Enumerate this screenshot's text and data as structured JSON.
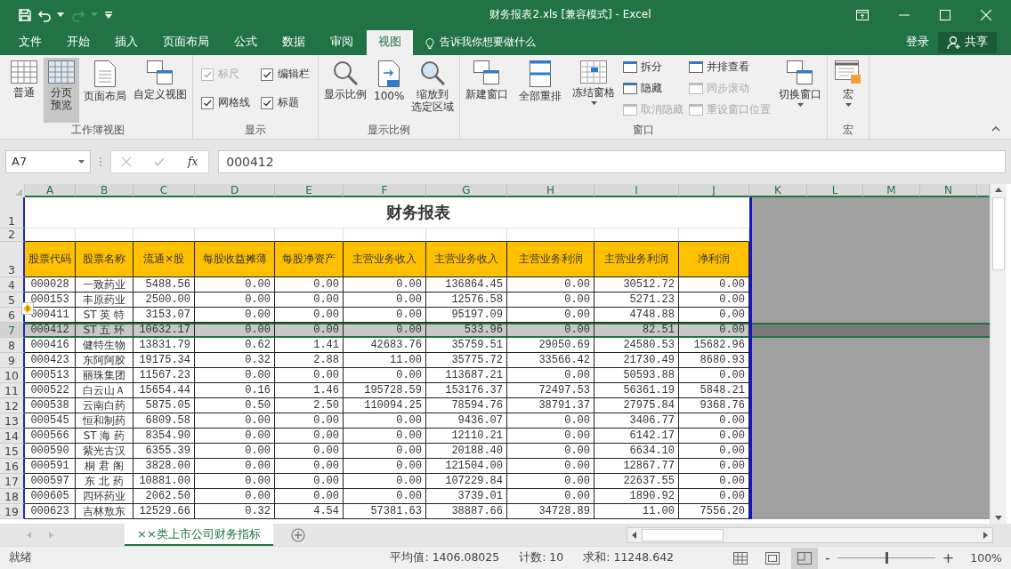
{
  "window": {
    "title": "财务报表2.xls  [兼容模式] - Excel"
  },
  "tabs": [
    {
      "label": "文件",
      "selected": false
    },
    {
      "label": "开始",
      "selected": false
    },
    {
      "label": "插入",
      "selected": false
    },
    {
      "label": "页面布局",
      "selected": false
    },
    {
      "label": "公式",
      "selected": false
    },
    {
      "label": "数据",
      "selected": false
    },
    {
      "label": "审阅",
      "selected": false
    },
    {
      "label": "视图",
      "selected": true
    }
  ],
  "tell_me": {
    "placeholder": "告诉我你想要做什么"
  },
  "sign_in": "登录",
  "share": "共享",
  "ribbon": {
    "groups": [
      {
        "label": "工作簿视图",
        "items": [
          {
            "kind": "large",
            "label": "普通",
            "selected": false,
            "disabled": false,
            "dropdown": false
          },
          {
            "kind": "large",
            "lines": [
              "分页",
              "预览"
            ],
            "selected": true,
            "disabled": false,
            "dropdown": false
          },
          {
            "kind": "large",
            "label": "页面布局",
            "selected": false,
            "disabled": false,
            "dropdown": false
          },
          {
            "kind": "large",
            "label": "自定义视图",
            "selected": false,
            "disabled": false,
            "dropdown": false
          }
        ]
      },
      {
        "label": "显示",
        "items": [
          {
            "kind": "check",
            "label": "标尺",
            "checked": true,
            "disabled": true
          },
          {
            "kind": "check",
            "label": "网格线",
            "checked": true,
            "disabled": false
          },
          {
            "kind": "check",
            "label": "编辑栏",
            "checked": true,
            "disabled": false
          },
          {
            "kind": "check",
            "label": "标题",
            "checked": true,
            "disabled": false
          }
        ]
      },
      {
        "label": "显示比例",
        "items": [
          {
            "kind": "large",
            "label": "显示比例",
            "selected": false,
            "disabled": false,
            "dropdown": false
          },
          {
            "kind": "large",
            "label": "100%",
            "selected": false,
            "disabled": false,
            "dropdown": false
          },
          {
            "kind": "large",
            "lines": [
              "缩放到",
              "选定区域"
            ],
            "selected": false,
            "disabled": false,
            "dropdown": false
          }
        ]
      },
      {
        "label": "窗口",
        "items": [
          {
            "kind": "large",
            "label": "新建窗口",
            "selected": false,
            "disabled": false,
            "dropdown": false
          },
          {
            "kind": "large",
            "label": "全部重排",
            "selected": false,
            "disabled": false,
            "dropdown": false
          },
          {
            "kind": "large",
            "label": "冻结窗格",
            "selected": false,
            "disabled": false,
            "dropdown": true
          },
          {
            "kind": "small",
            "label": "拆分",
            "disabled": false
          },
          {
            "kind": "small",
            "label": "隐藏",
            "disabled": false
          },
          {
            "kind": "small",
            "label": "取消隐藏",
            "disabled": true
          },
          {
            "kind": "small",
            "label": "并排查看",
            "disabled": false
          },
          {
            "kind": "small",
            "label": "同步滚动",
            "disabled": true
          },
          {
            "kind": "small",
            "label": "重设窗口位置",
            "disabled": true
          },
          {
            "kind": "large",
            "label": "切换窗口",
            "selected": false,
            "disabled": false,
            "dropdown": true
          }
        ]
      },
      {
        "label": "宏",
        "items": [
          {
            "kind": "large",
            "label": "宏",
            "selected": false,
            "disabled": false,
            "dropdown": true
          }
        ]
      }
    ]
  },
  "formula_bar": {
    "name_box": "A7",
    "function_label": "fx",
    "value": "000412"
  },
  "sheet": {
    "columns": [
      "A",
      "B",
      "C",
      "D",
      "E",
      "F",
      "G",
      "H",
      "I",
      "J",
      "K",
      "L",
      "M",
      "N"
    ],
    "title_row": "1",
    "title": "财务报表",
    "blank_row": "2",
    "header_row": "3",
    "headers": [
      "股票代码",
      "股票名称",
      "流通×股",
      "每股收益摊薄",
      "每股净资产",
      "主营业务收入",
      "主营业务收入",
      "主营业务利润",
      "主营业务利润",
      "净利润"
    ],
    "rows": [
      {
        "row": "4",
        "selected": false,
        "warning": false,
        "cells": [
          "000028",
          "一致药业",
          "5488.56",
          "0.00",
          "0.00",
          "0.00",
          "136864.45",
          "0.00",
          "30512.72",
          "0.00"
        ]
      },
      {
        "row": "5",
        "selected": false,
        "warning": false,
        "cells": [
          "000153",
          "丰原药业",
          "2500.00",
          "0.00",
          "0.00",
          "0.00",
          "12576.58",
          "0.00",
          "5271.23",
          "0.00"
        ]
      },
      {
        "row": "6",
        "selected": false,
        "warning": true,
        "cells": [
          "000411",
          "ST 英 特",
          "3153.07",
          "0.00",
          "0.00",
          "0.00",
          "95197.09",
          "0.00",
          "4748.88",
          "0.00"
        ]
      },
      {
        "row": "7",
        "selected": true,
        "warning": false,
        "cells": [
          "000412",
          "ST 五 环",
          "10632.17",
          "0.00",
          "0.00",
          "0.00",
          "533.96",
          "0.00",
          "82.51",
          "0.00"
        ]
      },
      {
        "row": "8",
        "selected": false,
        "warning": false,
        "cells": [
          "000416",
          "健特生物",
          "13831.79",
          "0.62",
          "1.41",
          "42683.76",
          "35759.51",
          "29050.69",
          "24580.53",
          "15682.96"
        ]
      },
      {
        "row": "9",
        "selected": false,
        "warning": false,
        "cells": [
          "000423",
          "东阿阿胶",
          "19175.34",
          "0.32",
          "2.88",
          "11.00",
          "35775.72",
          "33566.42",
          "21730.49",
          "8680.93"
        ]
      },
      {
        "row": "10",
        "selected": false,
        "warning": false,
        "cells": [
          "000513",
          "丽珠集团",
          "11567.23",
          "0.00",
          "0.00",
          "0.00",
          "113687.21",
          "0.00",
          "50593.88",
          "0.00"
        ]
      },
      {
        "row": "11",
        "selected": false,
        "warning": false,
        "cells": [
          "000522",
          "白云山Ａ",
          "15654.44",
          "0.16",
          "1.46",
          "195728.59",
          "153176.37",
          "72497.53",
          "56361.19",
          "5848.21"
        ]
      },
      {
        "row": "12",
        "selected": false,
        "warning": false,
        "cells": [
          "000538",
          "云南白药",
          "5875.05",
          "0.50",
          "2.50",
          "110094.25",
          "78594.76",
          "38791.37",
          "27975.84",
          "9368.76"
        ]
      },
      {
        "row": "13",
        "selected": false,
        "warning": false,
        "cells": [
          "000545",
          "恒和制药",
          "6809.58",
          "0.00",
          "0.00",
          "0.00",
          "9436.07",
          "0.00",
          "3406.77",
          "0.00"
        ]
      },
      {
        "row": "14",
        "selected": false,
        "warning": false,
        "cells": [
          "000566",
          "ST 海 药",
          "8354.90",
          "0.00",
          "0.00",
          "0.00",
          "12110.21",
          "0.00",
          "6142.17",
          "0.00"
        ]
      },
      {
        "row": "15",
        "selected": false,
        "warning": false,
        "cells": [
          "000590",
          "紫光古汉",
          "6355.39",
          "0.00",
          "0.00",
          "0.00",
          "20188.40",
          "0.00",
          "6634.10",
          "0.00"
        ]
      },
      {
        "row": "16",
        "selected": false,
        "warning": false,
        "cells": [
          "000591",
          "桐 君 阁",
          "3828.00",
          "0.00",
          "0.00",
          "0.00",
          "121504.00",
          "0.00",
          "12867.77",
          "0.00"
        ]
      },
      {
        "row": "17",
        "selected": false,
        "warning": false,
        "cells": [
          "000597",
          "东 北 药",
          "10881.00",
          "0.00",
          "0.00",
          "0.00",
          "107229.84",
          "0.00",
          "22637.55",
          "0.00"
        ]
      },
      {
        "row": "18",
        "selected": false,
        "warning": false,
        "cells": [
          "000605",
          "四环药业",
          "2062.50",
          "0.00",
          "0.00",
          "0.00",
          "3739.01",
          "0.00",
          "1890.92",
          "0.00"
        ]
      },
      {
        "row": "19",
        "selected": false,
        "warning": false,
        "cells": [
          "000623",
          "吉林敖东",
          "12529.66",
          "0.32",
          "4.54",
          "57381.63",
          "38887.66",
          "34728.89",
          "11.00",
          "7556.20"
        ]
      }
    ]
  },
  "sheet_tabs": [
    {
      "label": "××类上市公司财务指标",
      "selected": true
    }
  ],
  "status_bar": {
    "state": "就绪",
    "average": "平均值: 1406.08025",
    "count": "计数: 10",
    "sum": "求和: 11248.642",
    "views": [
      {
        "kind": "normal",
        "selected": false
      },
      {
        "kind": "page_layout",
        "selected": false
      },
      {
        "kind": "page_break",
        "selected": true
      }
    ],
    "zoom": {
      "minus": "-",
      "plus": "+",
      "level": 0.5,
      "reading": "100%"
    }
  }
}
